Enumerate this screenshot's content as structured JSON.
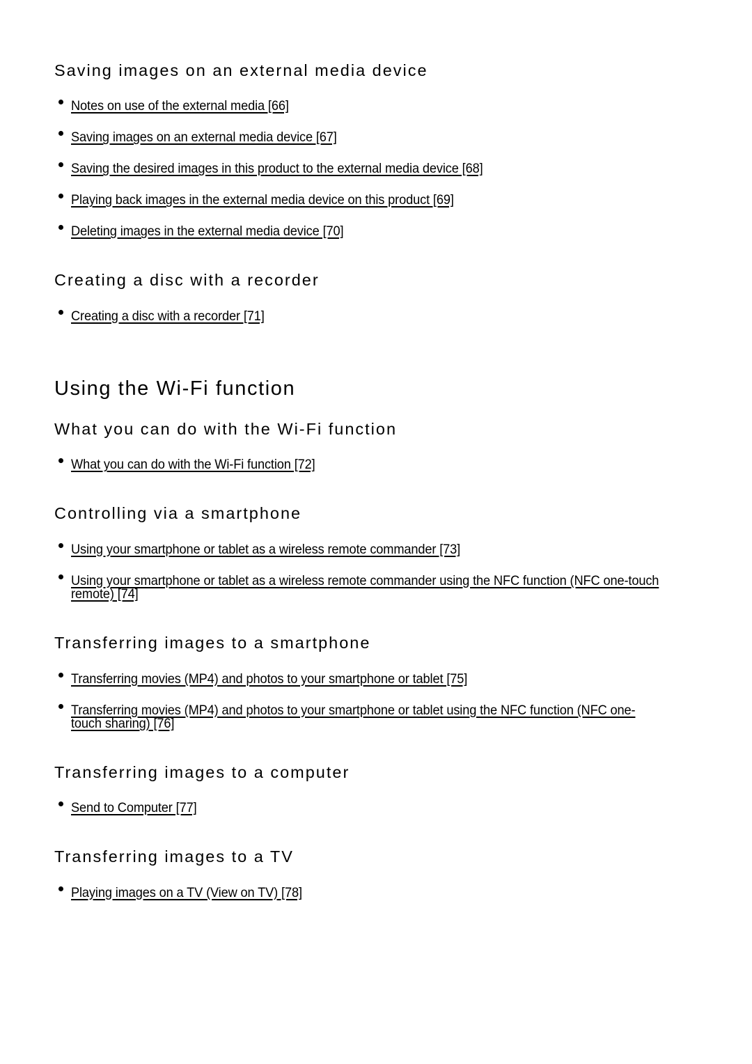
{
  "document": {
    "page_background": "#ffffff",
    "text_color": "#000000"
  },
  "sections": [
    {
      "id": "saving-images-external-media",
      "level": "h2",
      "heading": "Saving images on an external media device",
      "items": [
        {
          "text": "Notes on use of the external media [66]",
          "ref": "66"
        },
        {
          "text": "Saving images on an external media device [67]",
          "ref": "67"
        },
        {
          "text": "Saving the desired images in this product to the external media device [68]",
          "ref": "68"
        },
        {
          "text": "Playing back images in the external media device on this product [69]",
          "ref": "69"
        },
        {
          "text": "Deleting images in the external media device [70]",
          "ref": "70"
        }
      ]
    },
    {
      "id": "creating-a-disc",
      "level": "h2",
      "heading": "Creating a disc with a recorder",
      "items": [
        {
          "text": "Creating a disc with a recorder [71]",
          "ref": "71"
        }
      ]
    },
    {
      "id": "using-the-wifi-function",
      "level": "h1",
      "heading": "Using the Wi-Fi function",
      "items": []
    },
    {
      "id": "what-you-can-do-wifi",
      "level": "h2",
      "heading": "What you can do with the Wi-Fi function",
      "items": [
        {
          "text": "What you can do with the Wi-Fi function [72]",
          "ref": "72"
        }
      ]
    },
    {
      "id": "controlling-via-smartphone",
      "level": "h2",
      "heading": "Controlling via a smartphone",
      "items": [
        {
          "text": "Using your smartphone or tablet as a wireless remote commander [73]",
          "ref": "73"
        },
        {
          "text": "Using your smartphone or tablet as a wireless remote commander using the NFC function (NFC one-touch remote) [74]",
          "ref": "74"
        }
      ]
    },
    {
      "id": "transferring-images-smartphone",
      "level": "h2",
      "heading": "Transferring images to a smartphone",
      "items": [
        {
          "text": "Transferring movies (MP4) and photos to your smartphone or tablet [75]",
          "ref": "75"
        },
        {
          "text": "Transferring movies (MP4) and photos to your smartphone or tablet using the NFC function (NFC one-touch sharing) [76]",
          "ref": "76"
        }
      ]
    },
    {
      "id": "transferring-images-computer",
      "level": "h2",
      "heading": "Transferring images to a computer",
      "items": [
        {
          "text": "Send to Computer [77]",
          "ref": "77"
        }
      ]
    },
    {
      "id": "transferring-images-tv",
      "level": "h2",
      "heading": "Transferring images to a TV",
      "items": [
        {
          "text": "Playing images on a TV (View on TV) [78]",
          "ref": "78"
        }
      ]
    }
  ]
}
